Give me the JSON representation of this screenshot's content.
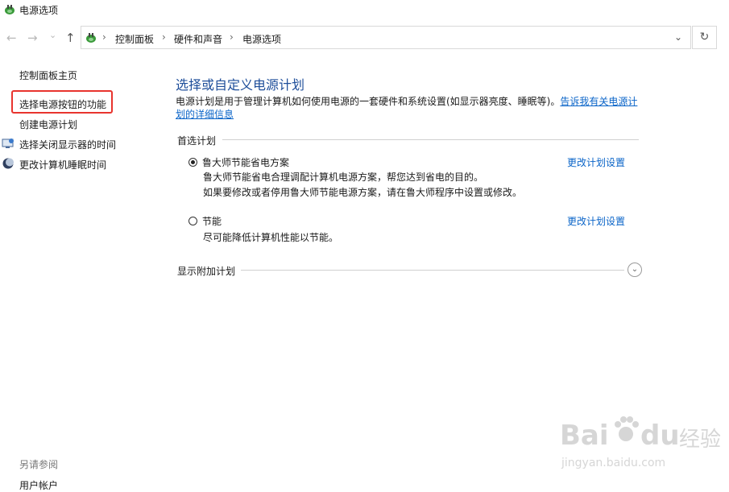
{
  "window": {
    "title": "电源选项"
  },
  "address": {
    "crumbs": [
      "控制面板",
      "硬件和声音",
      "电源选项"
    ],
    "separator": "›"
  },
  "nav": {
    "back": "←",
    "forward": "→",
    "recent": "⌄",
    "up": "↑",
    "dropdown": "⌄",
    "refresh": "↻"
  },
  "sidebar": {
    "home": "控制面板主页",
    "items": [
      {
        "label": "选择电源按钮的功能",
        "icon": null
      },
      {
        "label": "创建电源计划",
        "icon": null
      },
      {
        "label": "选择关闭显示器的时间",
        "icon": "monitor-icon"
      },
      {
        "label": "更改计算机睡眠时间",
        "icon": "moon-icon"
      }
    ],
    "see_also": "另请参阅",
    "user_accounts": "用户帐户"
  },
  "main": {
    "title": "选择或自定义电源计划",
    "description": "电源计划是用于管理计算机如何使用电源的一套硬件和系统设置(如显示器亮度、睡眠等)。",
    "description_link_1": "告诉我有关电源计",
    "description_link_2": "划的详细信息",
    "preferred_plans_label": "首选计划",
    "plans": [
      {
        "name": "鲁大师节能省电方案",
        "selected": true,
        "desc_lines": [
          "鲁大师节能省电合理调配计算机电源方案，帮您达到省电的目的。",
          "如果要修改或者停用鲁大师节能电源方案，请在鲁大师程序中设置或修改。"
        ],
        "change_link": "更改计划设置"
      },
      {
        "name": "节能",
        "selected": false,
        "desc_lines": [
          "尽可能降低计算机性能以节能。"
        ],
        "change_link": "更改计划设置"
      }
    ],
    "show_additional": "显示附加计划",
    "expand_glyph": "⌄"
  },
  "watermark": {
    "brand": "Bai",
    "brand2": "du",
    "suffix": "经验",
    "url": "jingyan.baidu.com"
  },
  "colors": {
    "title_blue": "#1e4e9a",
    "link_blue": "#0a64c8",
    "highlight_red": "#e8342e"
  }
}
